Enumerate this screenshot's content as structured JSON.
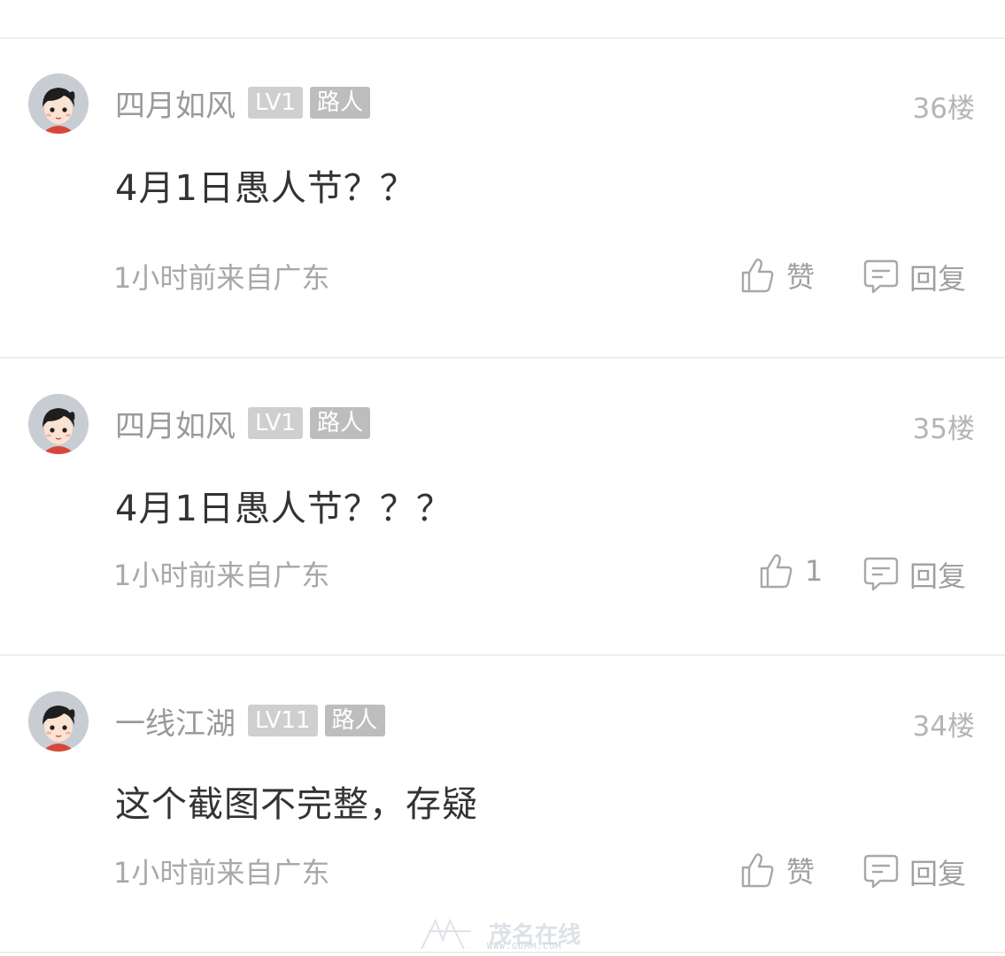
{
  "comments": [
    {
      "username": "四月如风",
      "level": "LV1",
      "role": "路人",
      "floor": "36楼",
      "text": "4月1日愚人节？？",
      "meta": "1小时前来自广东",
      "like_label": "赞",
      "reply_label": "回复"
    },
    {
      "username": "四月如风",
      "level": "LV1",
      "role": "路人",
      "floor": "35楼",
      "text": "4月1日愚人节？？？",
      "meta": "1小时前来自广东",
      "like_label": "1",
      "reply_label": "回复"
    },
    {
      "username": "一线江湖",
      "level": "LV11",
      "role": "路人",
      "floor": "34楼",
      "text": "这个截图不完整，存疑",
      "meta": "1小时前来自广东",
      "like_label": "赞",
      "reply_label": "回复"
    }
  ],
  "watermark": {
    "text": "WWW.GDMM.COM",
    "logo_text": "茂名在线"
  },
  "icons": {
    "like": "thumbs-up-icon",
    "reply": "comment-bubble-icon",
    "avatar": "cartoon-avatar-icon"
  }
}
